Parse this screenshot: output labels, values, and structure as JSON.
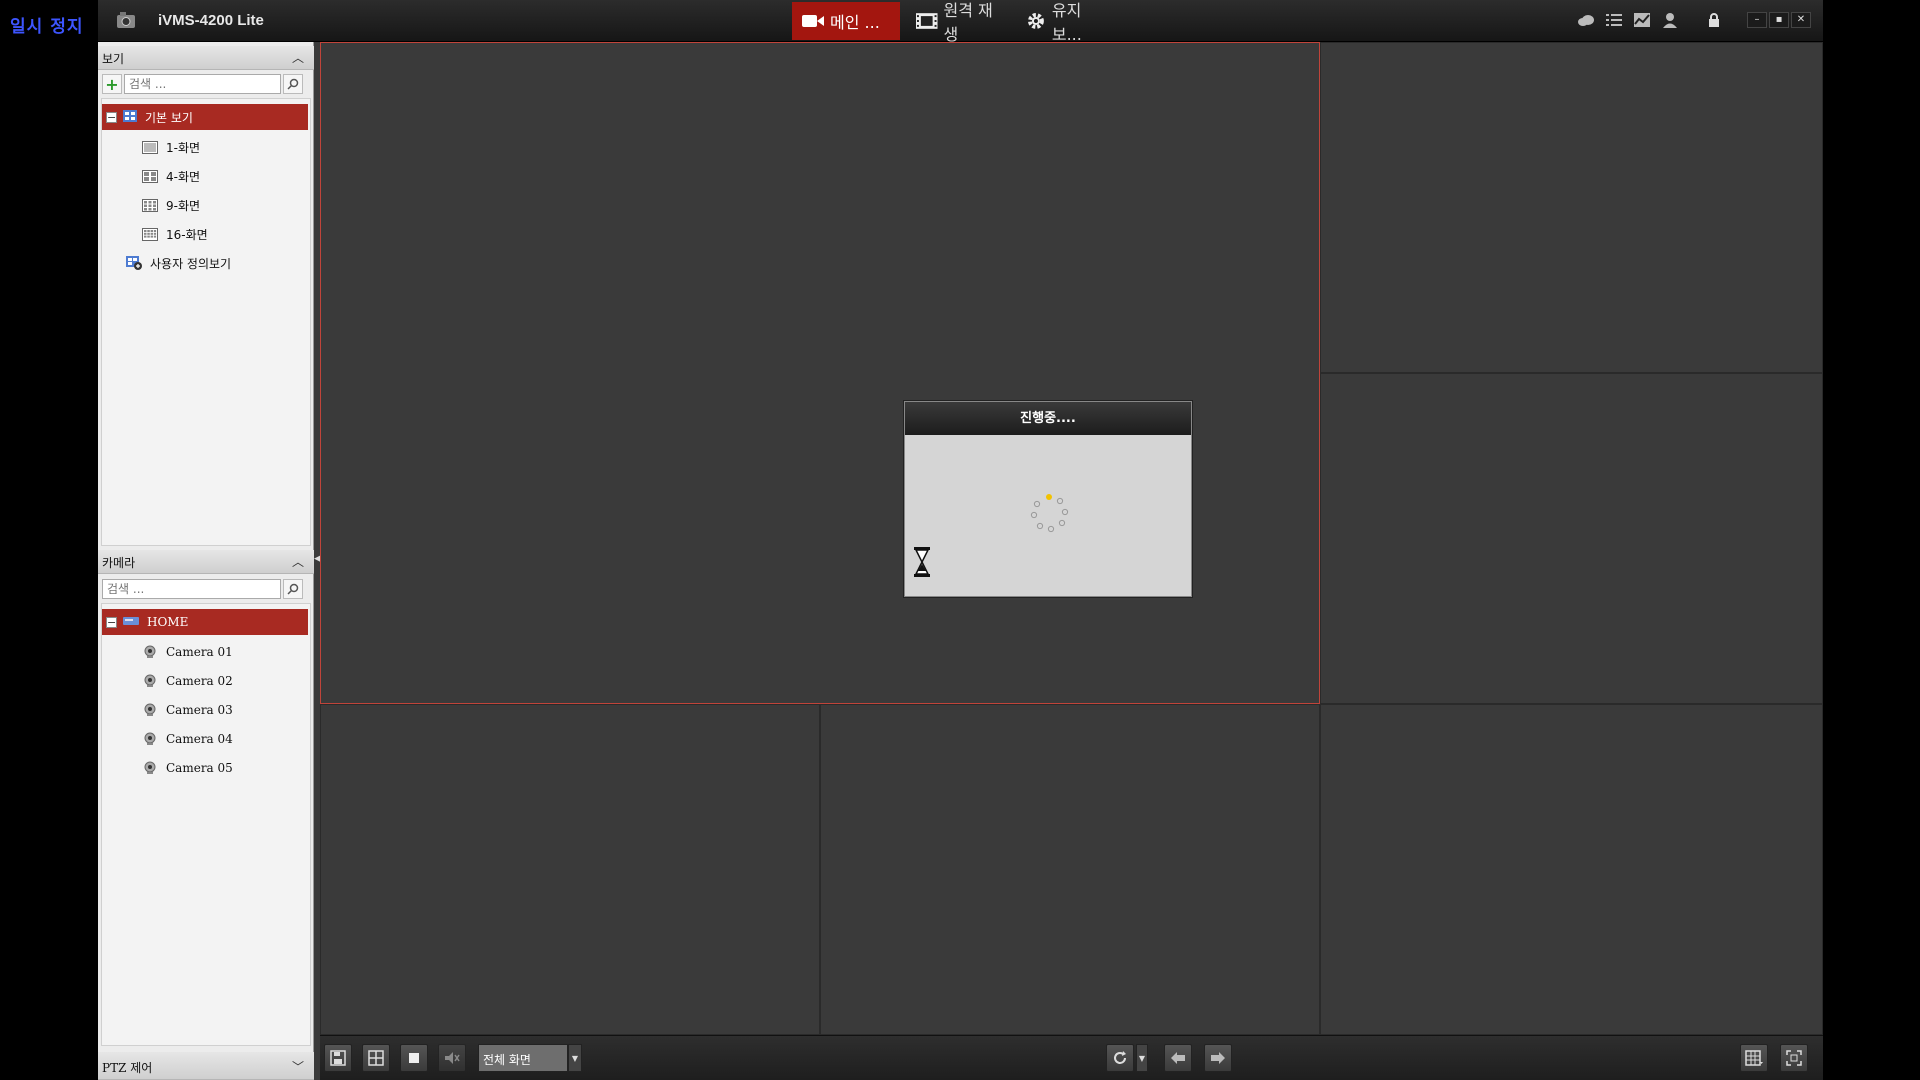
{
  "overlay": {
    "pause_label": "일시 정지"
  },
  "app": {
    "title": "iVMS-4200 Lite"
  },
  "tabs": [
    {
      "label": "메인 ...",
      "icon": "video-camera-icon",
      "active": true
    },
    {
      "label": "원격 재생",
      "icon": "film-icon",
      "active": false
    },
    {
      "label": "유지 보...",
      "icon": "gear-icon",
      "active": false
    }
  ],
  "titlebar_icons": [
    "cloud-icon",
    "list-icon",
    "chart-icon",
    "user-icon",
    "lock-icon"
  ],
  "window_controls": [
    "minimize",
    "maximize",
    "close"
  ],
  "view_panel": {
    "header": "보기",
    "search_placeholder": "검색 ...",
    "root": "기본 보기",
    "items": [
      "1-화면",
      "4-화면",
      "9-화면",
      "16-화면"
    ],
    "custom": "사용자 정의보기"
  },
  "camera_panel": {
    "header": "카메라",
    "search_placeholder": "검색 ...",
    "root": "HOME",
    "cameras": [
      "Camera 01",
      "Camera 02",
      "Camera 03",
      "Camera 04",
      "Camera 05"
    ]
  },
  "ptz_panel": {
    "header": "PTZ 제어"
  },
  "bottombar": {
    "screen_mode": "전체 화면"
  },
  "dialog": {
    "title": "진행중...."
  },
  "colors": {
    "accent": "#a3160f",
    "selected_border": "#c0443a",
    "pause_text": "#3d55ff"
  }
}
